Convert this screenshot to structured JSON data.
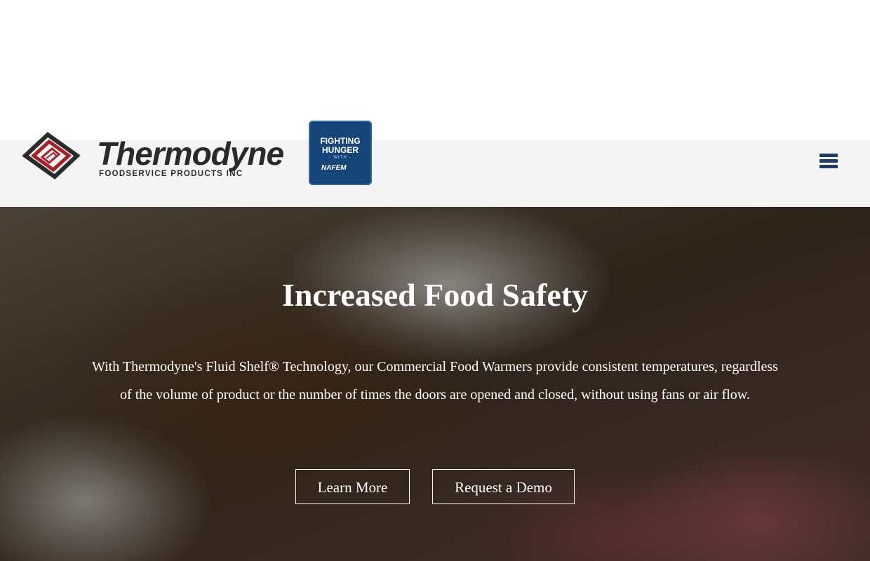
{
  "header": {
    "logo": {
      "wordmark": "Thermodyne",
      "tagline": "FOODSERVICE PRODUCTS  INC",
      "accent_color": "#a51f24",
      "text_color": "#2a2a2a"
    },
    "badge": {
      "line1": "FIGHTING",
      "line2": "HUNGER",
      "line3": "· WITH ·",
      "line4": "NAFEM",
      "color": "#16457a"
    },
    "menu_icon": "hamburger-menu-icon"
  },
  "hero": {
    "title": "Increased Food Safety",
    "description": "With Thermodyne's Fluid Shelf® Technology, our Commercial Food Warmers provide consistent temperatures, regardless of the volume of product or the number of times the doors are opened and closed, without using fans or air flow.",
    "buttons": {
      "learn_more": "Learn More",
      "request_demo": "Request a Demo"
    }
  }
}
